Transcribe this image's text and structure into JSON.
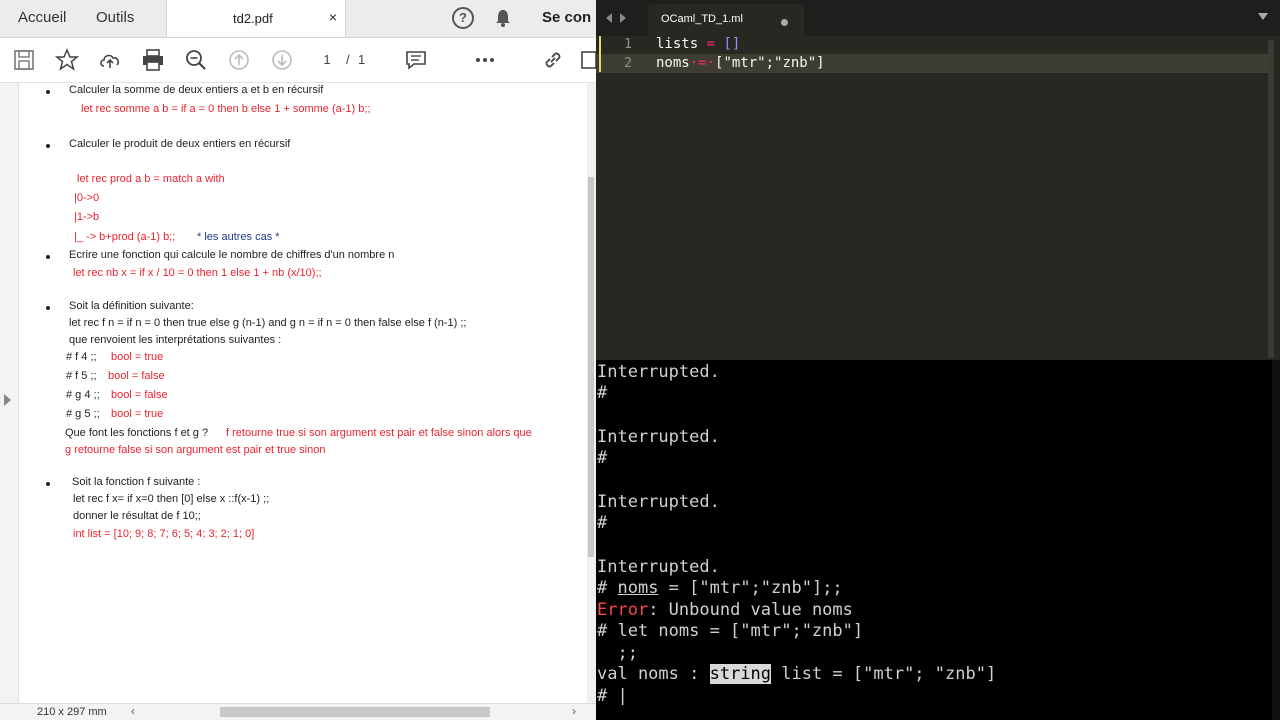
{
  "pdf": {
    "tabs": {
      "home": "Accueil",
      "tools": "Outils",
      "document": "td2.pdf",
      "close": "×",
      "signin": "Se con"
    },
    "page_current": "1",
    "page_sep": "/",
    "page_total": "1",
    "size_label": "210 x 297 mm",
    "lines": [
      "Calculer la somme de deux entiers a et b  en récursif",
      "let rec somme a b = if a = 0 then b else 1 + somme (a-1) b;;",
      "Calculer le produit de deux entiers en récursif",
      "let rec prod a b = match a with",
      "|0->0",
      "|1->b",
      "|_ -> b+prod (a-1) b;;",
      "* les autres cas *",
      "Ecrire une fonction qui calcule le nombre de chiffres d'un nombre n",
      "let rec nb x = if x / 10 = 0 then 1  else 1 + nb (x/10);;",
      "Soit la définition suivante:",
      "let rec f n = if n = 0 then true else g (n-1) and g n = if n = 0 then false else f (n-1) ;;",
      "que renvoient les interprétations suivantes :",
      "# f 4 ;;",
      "bool = true",
      "# f 5 ;;",
      "bool = false",
      "# g 4 ;;",
      "bool = false",
      "# g 5 ;;",
      "bool = true",
      "Que font les fonctions f et g ?",
      "f retourne true si son argument est pair et false sinon alors que",
      "g retourne false si son argument est pair et true sinon",
      "Soit la fonction f suivante :",
      "let rec f x= if x=0 then [0] else x ::f(x-1) ;;",
      "donner le résultat de f 10;;",
      "int list = [10; 9; 8; 7; 6; 5; 4; 3; 2; 1; 0]"
    ]
  },
  "editor": {
    "tab_label": "OCaml_TD_1.ml",
    "line_numbers": [
      "1",
      "2"
    ],
    "code": [
      [
        {
          "t": "lists",
          "c": "#f8f8f2"
        },
        {
          "t": " = ",
          "c": "#f92672"
        },
        {
          "t": "[]",
          "c": "#ae81ff"
        }
      ],
      [
        {
          "t": "noms",
          "c": "#f8f8f2"
        },
        {
          "t": "·=·",
          "c": "#f92672"
        },
        {
          "t": "[\"mtr\";\"znb\"]",
          "c": "#f8f8f2"
        }
      ]
    ]
  },
  "terminal": {
    "interrupted": "Interrupted.",
    "hash": "#",
    "cmd1_prefix": "# ",
    "cmd1_name": "noms",
    "cmd1_rest": " = [\"mtr\";\"znb\"];;",
    "err_label": "Error",
    "err_msg": ": Unbound value noms",
    "cmd2": "# let noms = [\"mtr\";\"znb\"]",
    "cont": "  ;;",
    "val_prefix": "val noms : ",
    "val_type": "string",
    "val_rest": " list = [\"mtr\"; \"znb\"]",
    "prompt": "# |"
  },
  "colors": {
    "pdf_red": "#e8242f",
    "pdf_blue": "#1e3a8a",
    "editor_bg": "#272822",
    "terminal_bg": "#000000"
  },
  "icons": [
    "save-icon",
    "star-icon",
    "upload-icon",
    "print-icon",
    "zoom-icon",
    "page-up-icon",
    "page-down-icon",
    "comment-icon",
    "more-icon",
    "link-icon",
    "help-icon",
    "bell-icon"
  ]
}
